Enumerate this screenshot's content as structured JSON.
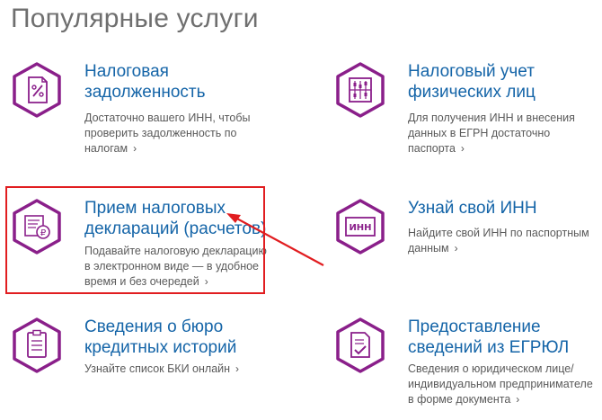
{
  "page": {
    "title": "Популярные услуги"
  },
  "colors": {
    "hex_border": "#8a1f8a",
    "link": "#1565a8",
    "highlight": "#e11d20"
  },
  "services": [
    {
      "icon": "percent-document-icon",
      "title_lines": [
        "Налоговая",
        "задолженность"
      ],
      "desc_lines": [
        "Достаточно вашего ИНН, чтобы",
        "проверить задолженность по",
        "налогам"
      ]
    },
    {
      "icon": "abacus-icon",
      "title_lines": [
        "Налоговый учет",
        "физических лиц"
      ],
      "desc_lines": [
        "Для получения ИНН и внесения",
        "данных в ЕГРН достаточно",
        "паспорта"
      ]
    },
    {
      "icon": "ruble-document-icon",
      "title_lines": [
        "Прием налоговых",
        "деклараций (расчетов)"
      ],
      "desc_lines": [
        "Подавайте налоговую декларацию",
        "в электронном виде — в удобное",
        "время и без очередей"
      ]
    },
    {
      "icon": "inn-card-icon",
      "title_lines": [
        "Узнай свой ИНН"
      ],
      "desc_lines": [
        "Найдите свой ИНН по паспортным",
        "данным"
      ]
    },
    {
      "icon": "clipboard-list-icon",
      "title_lines": [
        "Сведения о бюро",
        "кредитных историй"
      ],
      "desc_lines": [
        "Узнайте список БКИ онлайн"
      ]
    },
    {
      "icon": "document-check-icon",
      "title_lines": [
        "Предоставление",
        "сведений из ЕГРЮЛ"
      ],
      "desc_lines": [
        "Сведения о юридическом лице/",
        "индивидуальном предпринимателе",
        "в форме документа"
      ]
    }
  ],
  "inn_icon_text": "ИНН"
}
